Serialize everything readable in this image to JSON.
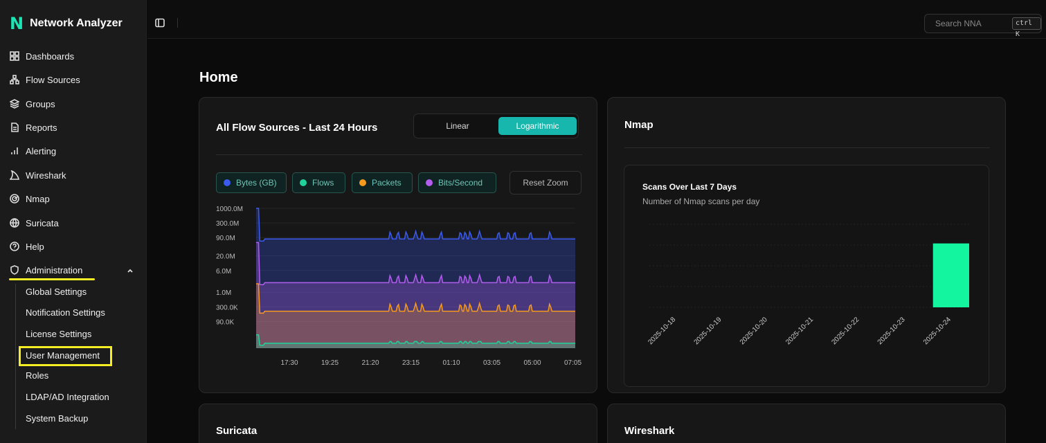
{
  "app": {
    "logo": "N",
    "title": "Network Analyzer"
  },
  "sidebar": {
    "items": [
      {
        "label": "Dashboards",
        "icon": "dashboard-icon"
      },
      {
        "label": "Flow Sources",
        "icon": "network-icon"
      },
      {
        "label": "Groups",
        "icon": "layers-icon"
      },
      {
        "label": "Reports",
        "icon": "report-icon"
      },
      {
        "label": "Alerting",
        "icon": "bar-chart-icon"
      },
      {
        "label": "Wireshark",
        "icon": "shark-fin-icon"
      },
      {
        "label": "Nmap",
        "icon": "scan-icon"
      },
      {
        "label": "Suricata",
        "icon": "globe-shield-icon"
      },
      {
        "label": "Help",
        "icon": "help-icon"
      },
      {
        "label": "Administration",
        "icon": "shield-icon"
      }
    ],
    "admin_subitems": [
      "Global Settings",
      "Notification Settings",
      "License Settings",
      "User Management",
      "Roles",
      "LDAP/AD Integration",
      "System Backup"
    ]
  },
  "topbar": {
    "search_placeholder": "Search NNA",
    "shortcut": "ctrl K"
  },
  "page": {
    "title": "Home"
  },
  "flow_card": {
    "title": "All Flow Sources - Last 24 Hours",
    "scale_options": [
      "Linear",
      "Logarithmic"
    ],
    "active_scale": "Logarithmic",
    "legend": [
      {
        "label": "Bytes (GB)",
        "color": "#3b5bf0"
      },
      {
        "label": "Flows",
        "color": "#1fd39a"
      },
      {
        "label": "Packets",
        "color": "#f59a1e"
      },
      {
        "label": "Bits/Second",
        "color": "#b35cf0"
      }
    ],
    "reset_zoom": "Reset Zoom"
  },
  "nmap_card": {
    "title": "Nmap",
    "chart_title": "Scans Over Last 7 Days",
    "chart_subtitle": "Number of Nmap scans per day"
  },
  "suricata_card": {
    "title": "Suricata"
  },
  "wireshark_card": {
    "title": "Wireshark"
  },
  "chart_data": [
    {
      "type": "area",
      "scale": "log",
      "y_ticks": [
        "1000.0M",
        "300.0M",
        "90.0M",
        "20.0M",
        "6.0M",
        "1.0M",
        "300.0K",
        "90.0K"
      ],
      "x_ticks": [
        "17:30",
        "19:25",
        "21:20",
        "23:15",
        "01:10",
        "03:05",
        "05:00",
        "07:05"
      ],
      "series": [
        {
          "name": "Bytes (GB)",
          "color": "#3b5bf0",
          "baseline": 80000000,
          "start_peak": 1000000000
        },
        {
          "name": "Bits/Second",
          "color": "#b35cf0",
          "baseline": 2200000,
          "start_peak": 60000000
        },
        {
          "name": "Packets",
          "color": "#f59a1e",
          "baseline": 210000,
          "start_peak": 2000000
        },
        {
          "name": "Flows",
          "color": "#1fd39a",
          "baseline": 15000,
          "start_peak": 30000
        }
      ],
      "ylim": [
        10000,
        1000000000
      ]
    },
    {
      "type": "bar",
      "categories": [
        "2025-10-18",
        "2025-10-19",
        "2025-10-20",
        "2025-10-21",
        "2025-10-22",
        "2025-10-23",
        "2025-10-24"
      ],
      "values": [
        0,
        0,
        0,
        0,
        0,
        0,
        1
      ],
      "bar_color": "#14f5a0",
      "ylim": [
        0,
        1.3
      ]
    }
  ]
}
